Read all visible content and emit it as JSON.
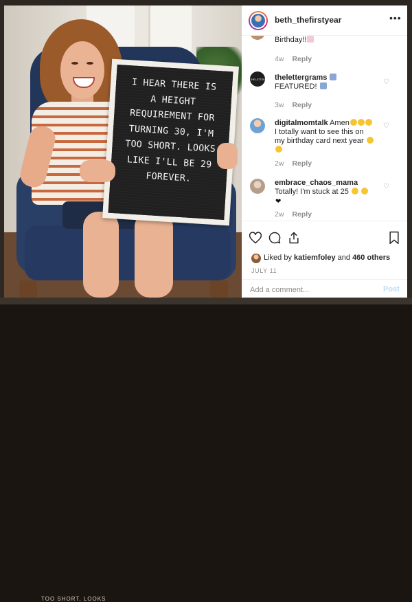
{
  "background": {
    "strip_text": "TOO SHORT, LOOKS"
  },
  "photo": {
    "board_lines": [
      "I HEAR THERE IS",
      "A HEIGHT",
      "REQUIREMENT FOR",
      "TURNING 30, I'M",
      "TOO SHORT. LOOKS",
      "LIKE I'LL BE 29",
      "FOREVER."
    ]
  },
  "post": {
    "username": "beth_thefirstyear",
    "more_icon": "ellipsis-icon",
    "colors": {
      "text": "#262626",
      "muted": "#8e8e8e",
      "link_disabled": "#b9dcf7"
    }
  },
  "comments": [
    {
      "partial_text": "Birthday!!",
      "age": "4w",
      "reply": "Reply"
    },
    {
      "user": "thelettergrams",
      "avatar_text": "THE LETTER GRAMS",
      "text": "FEATURED!",
      "age": "3w",
      "reply": "Reply"
    },
    {
      "user": "digitalmomtalk",
      "text_line1": "Amen",
      "text_line2": "I totally want to see this on",
      "text_line3": "my birthday card next year",
      "age": "2w",
      "reply": "Reply"
    },
    {
      "user": "embrace_chaos_mama",
      "text_line1": "Totally! I'm stuck at 25",
      "age": "2w",
      "reply": "Reply"
    }
  ],
  "actions": {
    "likes_prefix": "Liked by",
    "likes_user": "katiemfoley",
    "likes_and": "and",
    "likes_count": "460 others",
    "date": "JULY 11",
    "comment_placeholder": "Add a comment...",
    "post_label": "Post"
  }
}
